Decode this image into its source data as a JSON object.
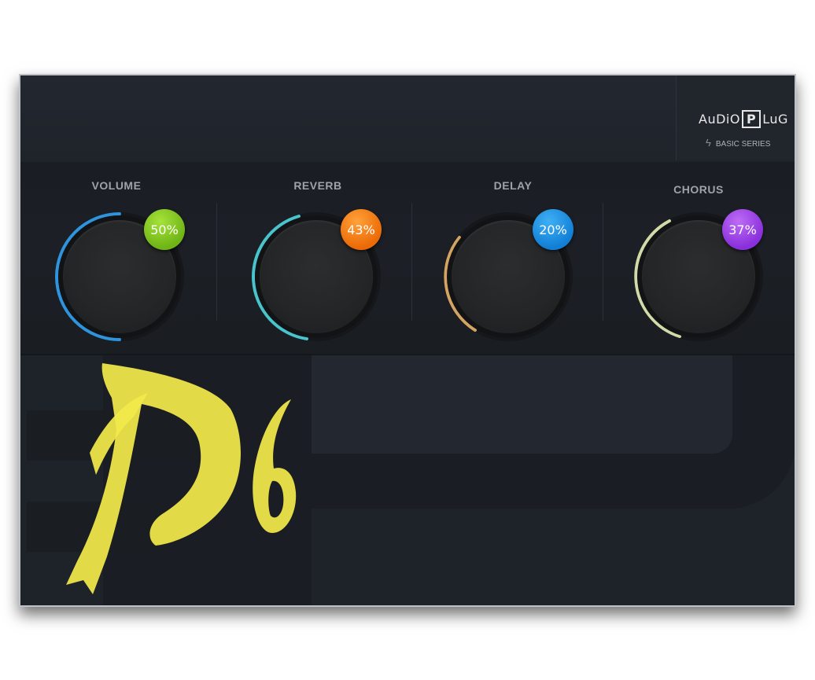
{
  "brand": {
    "pre": "AuDiO",
    "p": "P",
    "post": "LuG",
    "series": "BASIC SERIES"
  },
  "knobs": [
    {
      "label": "VOLUME",
      "value": "50%",
      "ring_color": "#2f9be8",
      "badge_color": "#79c21a"
    },
    {
      "label": "REVERB",
      "value": "43%",
      "ring_color": "#4fd6e0",
      "badge_color": "#f47d0d"
    },
    {
      "label": "DELAY",
      "value": "20%",
      "ring_color": "#e9b46a",
      "badge_color": "#1b8ee6"
    },
    {
      "label": "CHORUS",
      "value": "37%",
      "ring_color": "#e6f0b8",
      "badge_color": "#9a3ee6"
    }
  ],
  "accent": {
    "logo_yellow": "#f2e84a"
  }
}
